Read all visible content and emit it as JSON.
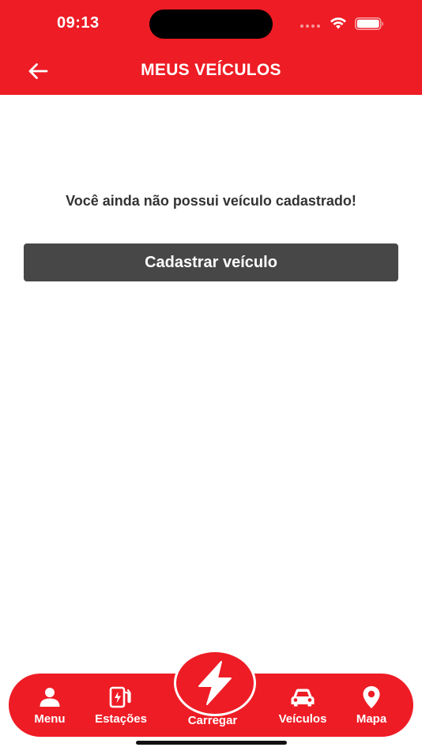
{
  "status_bar": {
    "time": "09:13"
  },
  "header": {
    "title": "MEUS VEÍCULOS",
    "back_icon": "arrow-left-icon"
  },
  "main": {
    "empty_message": "Você ainda não possui veículo cadastrado!",
    "register_button": "Cadastrar veículo"
  },
  "tabbar": {
    "items": [
      {
        "label": "Menu",
        "icon": "person-icon"
      },
      {
        "label": "Estações",
        "icon": "charging-station-icon"
      },
      {
        "label": "Carregar",
        "icon": "lightning-icon"
      },
      {
        "label": "Veículos",
        "icon": "car-icon"
      },
      {
        "label": "Mapa",
        "icon": "map-pin-icon"
      }
    ]
  },
  "colors": {
    "brand_red": "#ee1c25",
    "button_gray": "#474747",
    "text_dark": "#333333"
  }
}
